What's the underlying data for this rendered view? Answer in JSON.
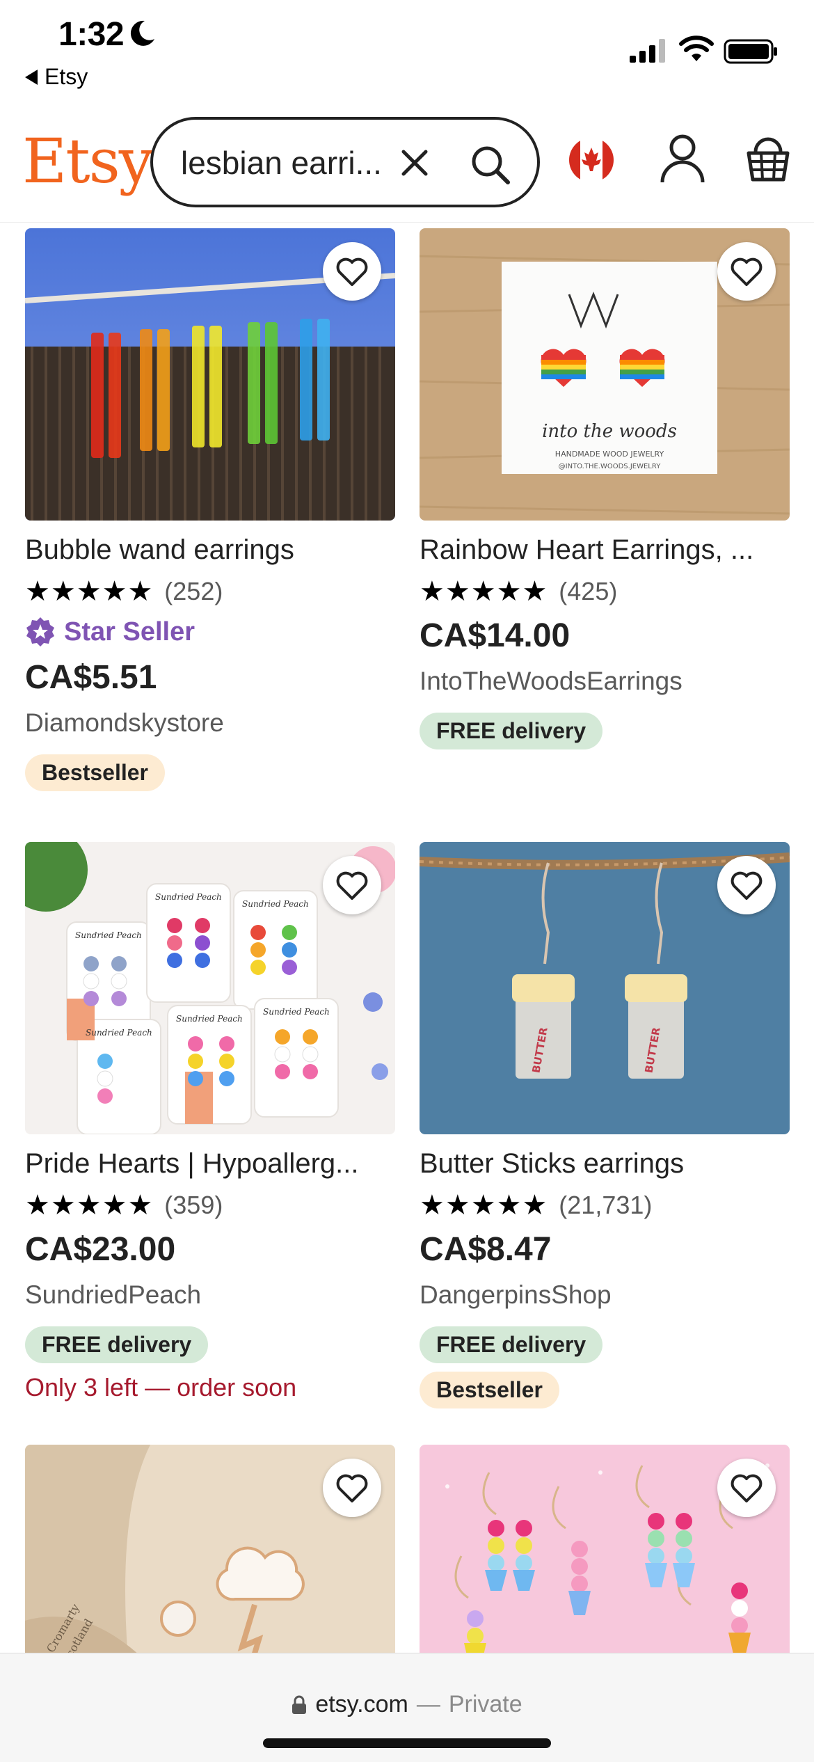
{
  "status_bar": {
    "time": "1:32",
    "back_app": "Etsy"
  },
  "header": {
    "logo": "Etsy",
    "search_value": "lesbian earri...",
    "icons": [
      "close-icon",
      "search-icon",
      "canada-flag-icon",
      "user-icon",
      "cart-icon"
    ]
  },
  "colors": {
    "brand": "#f1641e",
    "star_seller": "#7f54b3",
    "delivery_badge": "#d4e9d7",
    "bestseller_badge": "#fdebd2",
    "urgency": "#a61a2e"
  },
  "listings": [
    {
      "title": "Bubble wand earrings",
      "stars": "★★★★★",
      "reviews": "(252)",
      "star_seller": "Star Seller",
      "price": "CA$5.51",
      "shop": "Diamondskystore",
      "badge": "Bestseller"
    },
    {
      "title": "Rainbow Heart Earrings, ...",
      "stars": "★★★★★",
      "reviews": "(425)",
      "price": "CA$14.00",
      "shop": "IntoTheWoodsEarrings",
      "badge": "FREE delivery",
      "image_text": {
        "brand": "into the woods",
        "line1": "HANDMADE WOOD JEWELRY",
        "line2": "@INTO.THE.WOODS.JEWELRY"
      }
    },
    {
      "title": "Pride Hearts | Hypoallerg...",
      "stars": "★★★★★",
      "reviews": "(359)",
      "price": "CA$23.00",
      "shop": "SundriedPeach",
      "badge": "FREE delivery",
      "stock_note": "Only 3 left — order soon",
      "image_text": {
        "card_label": "Sundried Peach"
      }
    },
    {
      "title": "Butter Sticks earrings",
      "stars": "★★★★★",
      "reviews": "(21,731)",
      "price": "CA$8.47",
      "shop": "DangerpinsShop",
      "badge": "FREE delivery",
      "badge2": "Bestseller",
      "image_text": {
        "butter": "BUTTER"
      }
    },
    {
      "title": "",
      "image_text": {
        "stamp_line1": "Cromarty",
        "stamp_line2": "Scotland"
      }
    },
    {
      "title": ""
    }
  ],
  "browser": {
    "url": "etsy.com",
    "separator": "—",
    "mode": "Private"
  }
}
